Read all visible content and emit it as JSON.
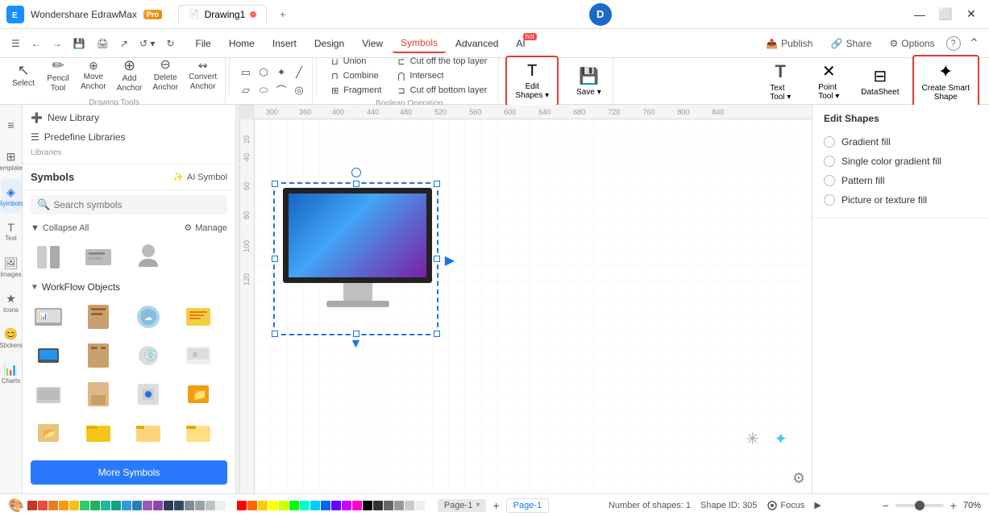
{
  "app": {
    "name": "Wondershare EdrawMax",
    "version": "Pro",
    "tab_drawing": "Drawing1",
    "dot_color": "#ff6b6b"
  },
  "title_bar": {
    "logo_text": "E",
    "tab_label": "Drawing1",
    "plus_label": "+",
    "d_avatar": "D",
    "min_btn": "—",
    "max_btn": "⬜",
    "close_btn": "✕"
  },
  "menu": {
    "back_icon": "⬅",
    "forward_icon": "➡",
    "items": [
      "File",
      "Home",
      "Insert",
      "Design",
      "View",
      "Symbols",
      "Advanced",
      "AI"
    ],
    "active_item": "Symbols",
    "ai_hot": "hot",
    "right_items": {
      "publish": "Publish",
      "share": "Share",
      "options": "Options"
    }
  },
  "toolbar": {
    "tools": [
      {
        "id": "select",
        "label": "Select",
        "icon": "↖"
      },
      {
        "id": "pencil",
        "label": "Pencil\nTool",
        "icon": "✏"
      },
      {
        "id": "move-anchor",
        "label": "Move\nAnchor",
        "icon": "⊕"
      },
      {
        "id": "add-anchor",
        "label": "Add\nAnchor",
        "icon": "+"
      },
      {
        "id": "delete-anchor",
        "label": "Delete\nAnchor",
        "icon": "−"
      },
      {
        "id": "convert-anchor",
        "label": "Convert\nAnchor",
        "icon": "⌂"
      }
    ],
    "drawing_tools_label": "Drawing Tools",
    "shapes": {
      "row1": [
        "▭",
        "⬡",
        "✦",
        "╱"
      ],
      "row2": [
        "▱",
        "⬬",
        "⌒",
        "⊙"
      ]
    },
    "boolean": {
      "label": "Boolean Operation",
      "items": [
        {
          "id": "union",
          "label": "Union",
          "icon": "⊔"
        },
        {
          "id": "combine",
          "label": "Combine",
          "icon": "⊓"
        },
        {
          "id": "fragment",
          "label": "Fragment",
          "icon": "⊞"
        },
        {
          "id": "intersect",
          "label": "Intersect",
          "icon": "⊓"
        },
        {
          "id": "cut-top",
          "label": "Cut off the top layer",
          "icon": "⊏"
        },
        {
          "id": "cut-bottom",
          "label": "Cut off bottom layer",
          "icon": "⊐"
        }
      ]
    },
    "edit_shapes": {
      "label": "Edit\nShapes",
      "dropdown": "▾"
    },
    "save": {
      "label": "Save",
      "icon": "💾"
    },
    "right_tools": [
      {
        "id": "text-tool",
        "label": "Text\nTool",
        "icon": "T",
        "has_dropdown": true
      },
      {
        "id": "point-tool",
        "label": "Point\nTool",
        "icon": "⊕",
        "has_dropdown": true
      },
      {
        "id": "datasheet",
        "label": "DataSheet",
        "icon": "⊟"
      },
      {
        "id": "create-smart-shape",
        "label": "Create Smart\nShape",
        "icon": "✦"
      }
    ]
  },
  "symbols_panel": {
    "title": "Symbols",
    "ai_symbol_label": "AI Symbol",
    "search_placeholder": "Search symbols",
    "collapse_all": "Collapse All",
    "manage": "Manage",
    "libraries": [
      {
        "id": "new-library",
        "label": "New Library",
        "icon": "+"
      },
      {
        "id": "predefine",
        "label": "Predefine Libraries",
        "icon": "☰"
      }
    ],
    "libraries_section_label": "Libraries",
    "categories": [
      {
        "id": "workflow",
        "label": "WorkFlow Objects",
        "expanded": true,
        "items": 12
      }
    ],
    "more_symbols_label": "More Symbols"
  },
  "right_panel": {
    "title": "Edit Shapes",
    "options": [
      {
        "id": "gradient-fill",
        "label": "Gradient fill",
        "checked": false
      },
      {
        "id": "single-color-gradient",
        "label": "Single color gradient fill",
        "checked": false
      },
      {
        "id": "pattern-fill",
        "label": "Pattern fill",
        "checked": false
      },
      {
        "id": "picture-texture-fill",
        "label": "Picture or texture fill",
        "checked": false
      }
    ]
  },
  "canvas": {
    "ruler_marks_h": [
      "300",
      "360",
      "400",
      "440",
      "480",
      "520",
      "560",
      "600",
      "640",
      "680",
      "720",
      "760",
      "800",
      "840"
    ],
    "ruler_marks_v": [
      "20",
      "40",
      "60",
      "80",
      "100",
      "120"
    ],
    "grid_color": "#e8e8e8"
  },
  "status_bar": {
    "page1_label": "Page-1",
    "add_page": "+",
    "active_page": "Page-1",
    "shapes_count": "Number of shapes: 1",
    "shape_id": "Shape ID: 305",
    "focus_label": "Focus",
    "zoom_in": "+",
    "zoom_out": "−",
    "zoom_level": "70%"
  },
  "colors": [
    "#c0392b",
    "#e74c3c",
    "#e67e22",
    "#f39c12",
    "#f1c40f",
    "#2ecc71",
    "#27ae60",
    "#1abc9c",
    "#16a085",
    "#3498db",
    "#2980b9",
    "#9b59b6",
    "#8e44ad",
    "#2c3e50",
    "#34495e",
    "#7f8c8d",
    "#95a5a6",
    "#bdc3c7",
    "#ecf0f1",
    "#fff",
    "#ff0000",
    "#ff6600",
    "#ffcc00",
    "#ffff00",
    "#ccff00",
    "#00ff00",
    "#00ffcc",
    "#00ccff",
    "#0066ff",
    "#6600ff",
    "#cc00ff",
    "#ff00cc",
    "#000",
    "#333",
    "#666",
    "#999",
    "#ccc",
    "#eee"
  ]
}
